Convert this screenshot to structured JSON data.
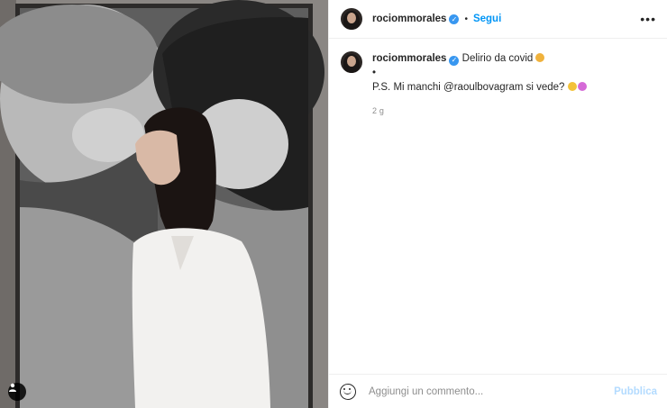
{
  "post": {
    "username": "rociommorales",
    "follow_label": "Segui",
    "separator": "•",
    "more_label": "•••",
    "caption_text": "Delirio da covid",
    "caption_line2": "•",
    "caption_line3": "P.S. Mi manchi @raoulbovagram si vede?",
    "time_ago": "2 g"
  },
  "comment": {
    "placeholder": "Aggiungi un commento...",
    "publish_label": "Pubblica"
  },
  "colors": {
    "link_blue": "#0095f6",
    "verified_blue": "#3897f0",
    "publish_disabled": "#b3dbff"
  }
}
